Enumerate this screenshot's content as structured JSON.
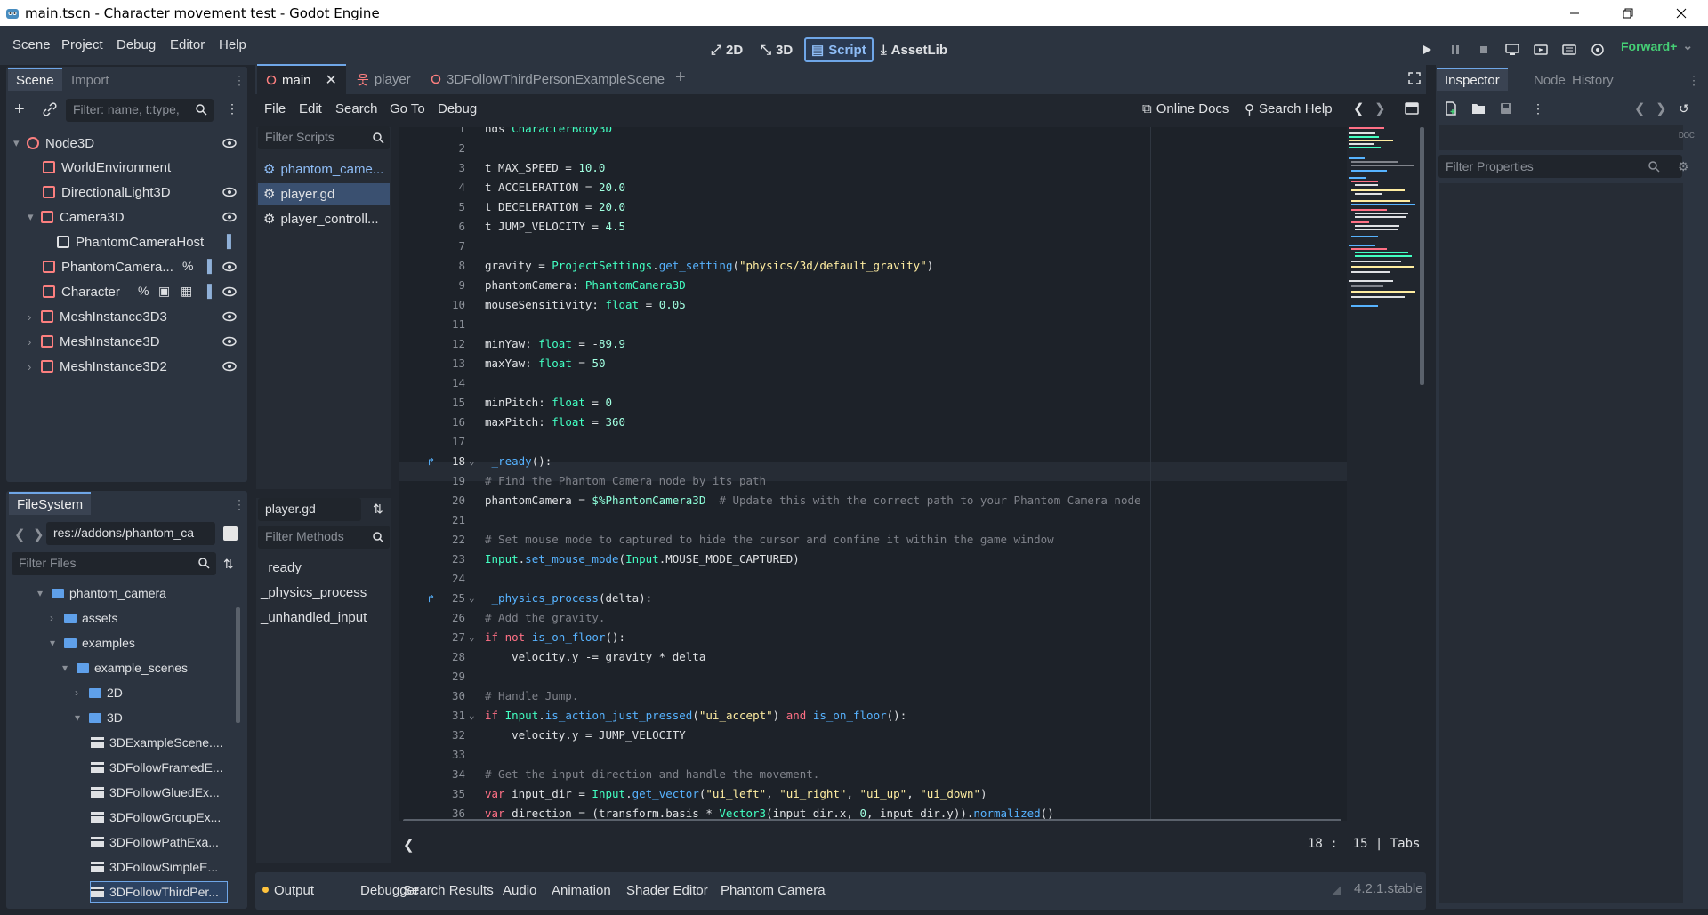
{
  "window": {
    "title": "main.tscn - Character movement test - Godot Engine"
  },
  "menu": {
    "items": [
      "Scene",
      "Project",
      "Debug",
      "Editor",
      "Help"
    ]
  },
  "workspaces": {
    "items": [
      "2D",
      "3D",
      "Script",
      "AssetLib"
    ],
    "active": "Script"
  },
  "renderer": "Forward+",
  "scene_dock": {
    "tabs": [
      "Scene",
      "Import"
    ],
    "filter_placeholder": "Filter: name, t:type,",
    "tree": [
      {
        "label": "Node3D",
        "depth": 0,
        "icon": "node3d-icon",
        "color": "#fc7f7f"
      },
      {
        "label": "WorldEnvironment",
        "depth": 1,
        "icon": "globe-icon",
        "color": "#fc7f7f"
      },
      {
        "label": "DirectionalLight3D",
        "depth": 1,
        "icon": "light-icon",
        "color": "#fc7f7f"
      },
      {
        "label": "Camera3D",
        "depth": 1,
        "icon": "camera-icon",
        "color": "#fc7f7f"
      },
      {
        "label": "PhantomCameraHost",
        "depth": 2,
        "icon": "phantom-host-icon",
        "color": "#dfe1e4"
      },
      {
        "label": "PhantomCamera...",
        "depth": 1,
        "icon": "phantom-camera-icon",
        "color": "#fc7f7f"
      },
      {
        "label": "Character",
        "depth": 1,
        "icon": "character-icon",
        "color": "#fc7f7f"
      },
      {
        "label": "MeshInstance3D3",
        "depth": 1,
        "icon": "mesh-icon",
        "color": "#fc7f7f"
      },
      {
        "label": "MeshInstance3D",
        "depth": 1,
        "icon": "mesh-icon",
        "color": "#fc7f7f"
      },
      {
        "label": "MeshInstance3D2",
        "depth": 1,
        "icon": "mesh-icon",
        "color": "#fc7f7f"
      }
    ]
  },
  "filesystem": {
    "tab": "FileSystem",
    "path": "res://addons/phantom_ca",
    "filter_placeholder": "Filter Files",
    "items": [
      {
        "label": "phantom_camera",
        "type": "folder"
      },
      {
        "label": "assets",
        "type": "folder"
      },
      {
        "label": "examples",
        "type": "folder"
      },
      {
        "label": "example_scenes",
        "type": "folder"
      },
      {
        "label": "2D",
        "type": "folder"
      },
      {
        "label": "3D",
        "type": "folder"
      },
      {
        "label": "3DExampleScene....",
        "type": "scene"
      },
      {
        "label": "3DFollowFramedE...",
        "type": "scene"
      },
      {
        "label": "3DFollowGluedEx...",
        "type": "scene"
      },
      {
        "label": "3DFollowGroupEx...",
        "type": "scene"
      },
      {
        "label": "3DFollowPathExa...",
        "type": "scene"
      },
      {
        "label": "3DFollowSimpleE...",
        "type": "scene"
      },
      {
        "label": "3DFollowThirdPer...",
        "type": "scene"
      }
    ]
  },
  "editor_tabs": [
    "main",
    "player",
    "3DFollowThirdPersonExampleScene"
  ],
  "script_menu": [
    "File",
    "Edit",
    "Search",
    "Go To",
    "Debug"
  ],
  "script_help": {
    "online_docs": "Online Docs",
    "search_help": "Search Help"
  },
  "scripts": {
    "filter_placeholder": "Filter Scripts",
    "items": [
      "phantom_came...",
      "player.gd",
      "player_controll..."
    ],
    "current_file": "player.gd",
    "methods_filter_placeholder": "Filter Methods",
    "methods": [
      "_ready",
      "_physics_process",
      "_unhandled_input"
    ]
  },
  "code": {
    "lines": [
      {
        "n": "1",
        "t": "nds CharacterBody3D"
      },
      {
        "n": "2",
        "t": ""
      },
      {
        "n": "3",
        "t": "t MAX_SPEED = 10.0"
      },
      {
        "n": "4",
        "t": "t ACCELERATION = 20.0"
      },
      {
        "n": "5",
        "t": "t DECELERATION = 20.0"
      },
      {
        "n": "6",
        "t": "t JUMP_VELOCITY = 4.5"
      },
      {
        "n": "7",
        "t": ""
      },
      {
        "n": "8",
        "t": "gravity = ProjectSettings.get_setting(\"physics/3d/default_gravity\")"
      },
      {
        "n": "9",
        "t": "phantomCamera: PhantomCamera3D"
      },
      {
        "n": "10",
        "t": "mouseSensitivity: float = 0.05"
      },
      {
        "n": "11",
        "t": ""
      },
      {
        "n": "12",
        "t": "minYaw: float = -89.9"
      },
      {
        "n": "13",
        "t": "maxYaw: float = 50"
      },
      {
        "n": "14",
        "t": ""
      },
      {
        "n": "15",
        "t": "minPitch: float = 0"
      },
      {
        "n": "16",
        "t": "maxPitch: float = 360"
      },
      {
        "n": "17",
        "t": ""
      },
      {
        "n": "18",
        "t": " _ready():"
      },
      {
        "n": "19",
        "t": "# Find the Phantom Camera node by its path"
      },
      {
        "n": "20",
        "t": "phantomCamera = $%PhantomCamera3D  # Update this with the correct path to your Phantom Camera node"
      },
      {
        "n": "21",
        "t": ""
      },
      {
        "n": "22",
        "t": "# Set mouse mode to captured to hide the cursor and confine it within the game window"
      },
      {
        "n": "23",
        "t": "Input.set_mouse_mode(Input.MOUSE_MODE_CAPTURED)"
      },
      {
        "n": "24",
        "t": ""
      },
      {
        "n": "25",
        "t": " _physics_process(delta):"
      },
      {
        "n": "26",
        "t": "# Add the gravity."
      },
      {
        "n": "27",
        "t": "if not is_on_floor():"
      },
      {
        "n": "28",
        "t": "    velocity.y -= gravity * delta"
      },
      {
        "n": "29",
        "t": ""
      },
      {
        "n": "30",
        "t": "# Handle Jump."
      },
      {
        "n": "31",
        "t": "if Input.is_action_just_pressed(\"ui_accept\") and is_on_floor():"
      },
      {
        "n": "32",
        "t": "    velocity.y = JUMP_VELOCITY"
      },
      {
        "n": "33",
        "t": ""
      },
      {
        "n": "34",
        "t": "# Get the input direction and handle the movement."
      },
      {
        "n": "35",
        "t": "var input_dir = Input.get_vector(\"ui_left\", \"ui_right\", \"ui_up\", \"ui_down\")"
      },
      {
        "n": "36",
        "t": "var direction = (transform.basis * Vector3(input_dir.x, 0, input_dir.y)).normalized()"
      }
    ],
    "current_line": "18"
  },
  "status": {
    "line": "18",
    "col": "15",
    "indent": "Tabs"
  },
  "bottom_tabs": [
    "Output",
    "Debugger",
    "Search Results",
    "Audio",
    "Animation",
    "Shader Editor",
    "Phantom Camera"
  ],
  "version": "4.2.1.stable",
  "inspector": {
    "tabs": [
      "Inspector",
      "Node",
      "History"
    ],
    "filter_placeholder": "Filter Properties"
  }
}
